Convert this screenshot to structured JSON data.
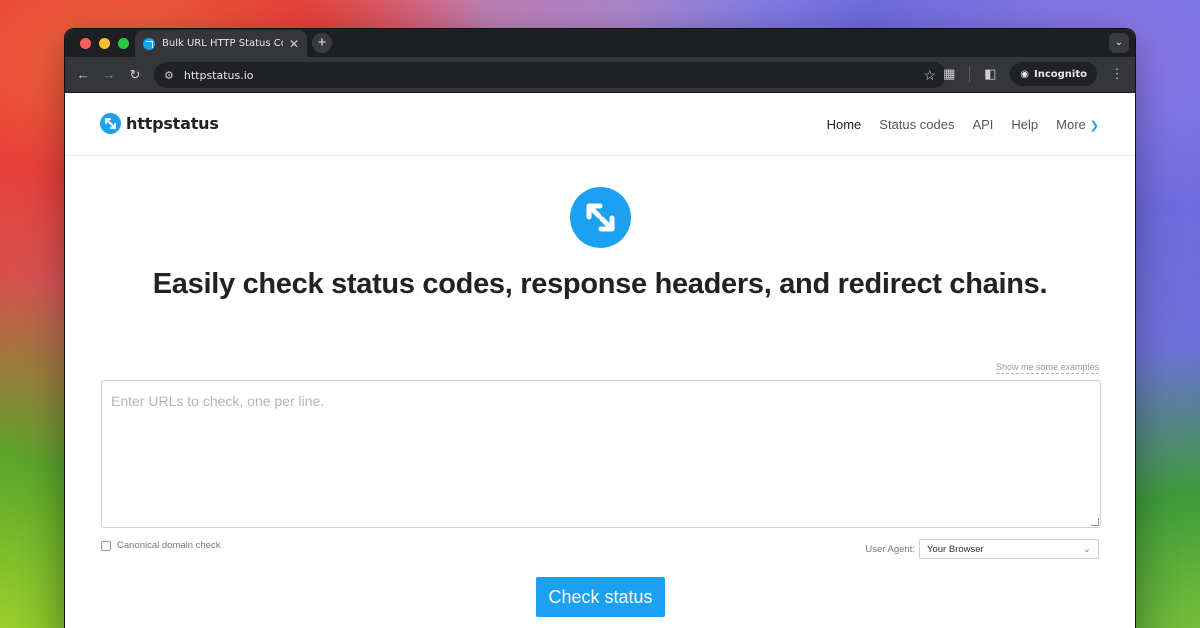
{
  "browser": {
    "tab_title": "Bulk URL HTTP Status Code,",
    "tab_close": "✕",
    "new_tab": "+",
    "url": "httpstatus.io",
    "incognito_label": "Incognito"
  },
  "site": {
    "logo_text": "httpstatus",
    "nav": [
      {
        "label": "Home"
      },
      {
        "label": "Status codes"
      },
      {
        "label": "API"
      },
      {
        "label": "Help"
      },
      {
        "label": "More"
      }
    ]
  },
  "hero": {
    "pre": "Easily check ",
    "b1": "status codes",
    "sep1": ", ",
    "b2": "response headers",
    "sep2": ", and ",
    "b3": "redirect chains",
    "end": "."
  },
  "form": {
    "examples_link": "Show me some examples",
    "urls_placeholder": "Enter URLs to check, one per line.",
    "canonical_label": "Canonical domain check",
    "user_agent_label": "User Agent:",
    "user_agent_value": "Your Browser",
    "submit_label": "Check status"
  },
  "colors": {
    "accent": "#1ba1f2"
  }
}
